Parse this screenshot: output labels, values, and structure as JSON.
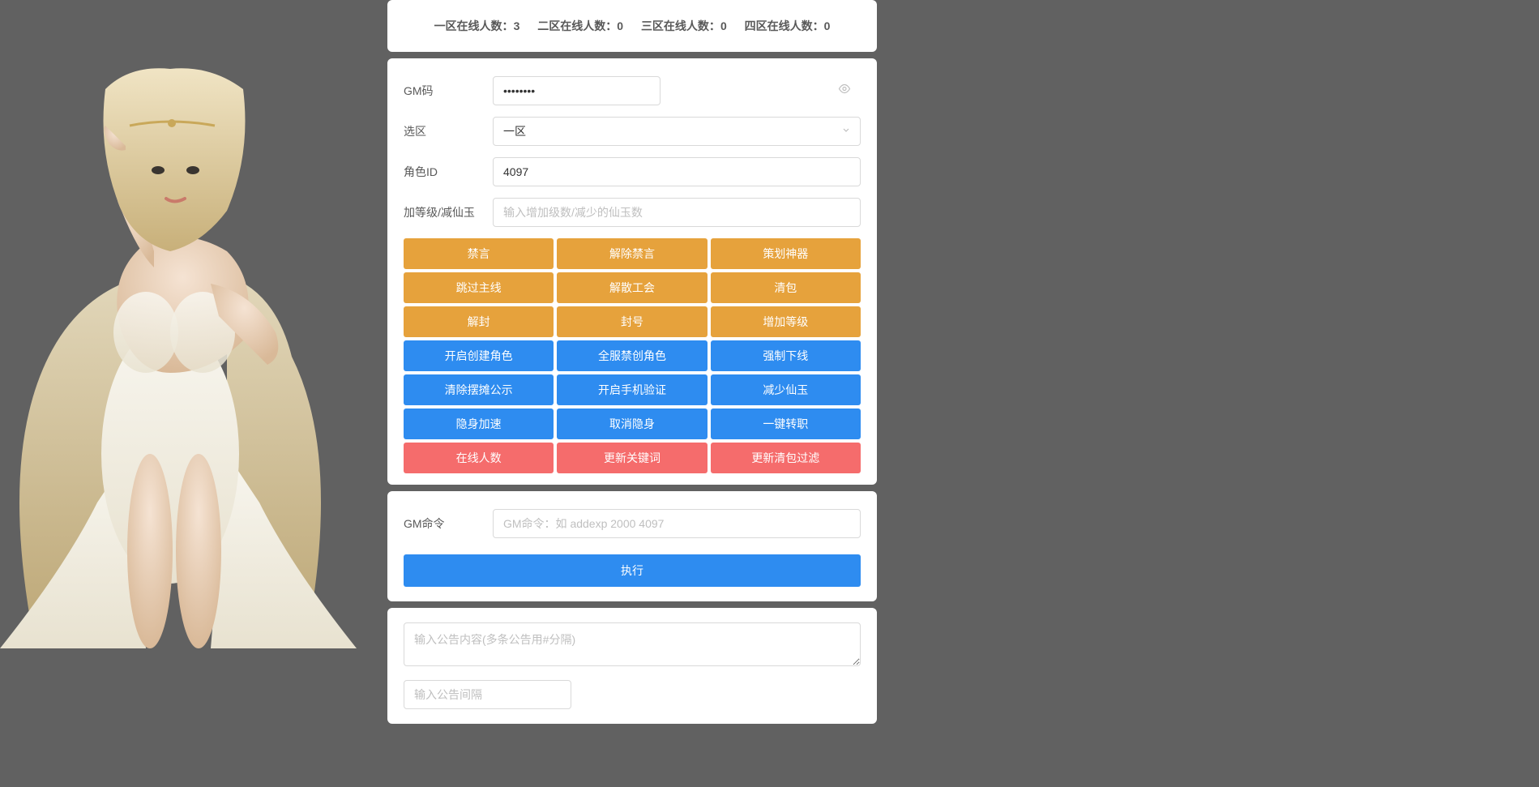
{
  "status": {
    "zone1": {
      "label": "一区在线人数：",
      "count": "3"
    },
    "zone2": {
      "label": "二区在线人数：",
      "count": "0"
    },
    "zone3": {
      "label": "三区在线人数：",
      "count": "0"
    },
    "zone4": {
      "label": "四区在线人数：",
      "count": "0"
    }
  },
  "form": {
    "gmcode": {
      "label": "GM码",
      "value": "••••••••"
    },
    "zone": {
      "label": "选区",
      "selected": "一区"
    },
    "roleid": {
      "label": "角色ID",
      "value": "4097"
    },
    "addlevel": {
      "label": "加等级/减仙玉",
      "placeholder": "输入增加级数/减少的仙玉数"
    }
  },
  "buttons": {
    "orange": [
      {
        "label": "禁言",
        "name": "mute-button"
      },
      {
        "label": "解除禁言",
        "name": "unmute-button"
      },
      {
        "label": "策划神器",
        "name": "planner-tool-button"
      },
      {
        "label": "跳过主线",
        "name": "skip-main-button"
      },
      {
        "label": "解散工会",
        "name": "dissolve-guild-button"
      },
      {
        "label": "清包",
        "name": "clear-bag-button"
      },
      {
        "label": "解封",
        "name": "unban-button"
      },
      {
        "label": "封号",
        "name": "ban-button"
      },
      {
        "label": "增加等级",
        "name": "add-level-button"
      }
    ],
    "blue": [
      {
        "label": "开启创建角色",
        "name": "enable-create-role-button"
      },
      {
        "label": "全服禁创角色",
        "name": "disable-create-role-button"
      },
      {
        "label": "强制下线",
        "name": "force-offline-button"
      },
      {
        "label": "清除摆摊公示",
        "name": "clear-stall-button"
      },
      {
        "label": "开启手机验证",
        "name": "enable-phone-verify-button"
      },
      {
        "label": "减少仙玉",
        "name": "reduce-jade-button"
      },
      {
        "label": "隐身加速",
        "name": "invisible-speed-button"
      },
      {
        "label": "取消隐身",
        "name": "cancel-invisible-button"
      },
      {
        "label": "一键转职",
        "name": "change-job-button"
      }
    ],
    "red": [
      {
        "label": "在线人数",
        "name": "online-count-button"
      },
      {
        "label": "更新关键词",
        "name": "update-keywords-button"
      },
      {
        "label": "更新清包过滤",
        "name": "update-bag-filter-button"
      }
    ]
  },
  "cmd": {
    "label": "GM命令",
    "placeholder": "GM命令：如 addexp 2000 4097",
    "execute_label": "执行"
  },
  "announce": {
    "content_placeholder": "输入公告内容(多条公告用#分隔)",
    "interval_placeholder": "输入公告间隔"
  }
}
